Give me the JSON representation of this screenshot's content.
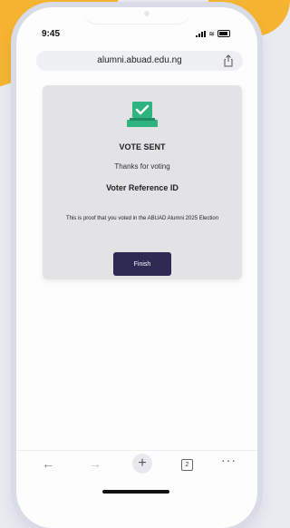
{
  "status": {
    "time": "9:45"
  },
  "browser": {
    "url": "alumni.abuad.edu.ng"
  },
  "card": {
    "title": "VOTE SENT",
    "thanks": "Thanks for voting",
    "reference_label": "Voter Reference ID",
    "proof_text": "This is proof that you voted in the ABUAD Alumni 2025 Election",
    "finish_label": "Finish"
  },
  "toolbar": {
    "tabs_count": "2"
  },
  "icons": {
    "ballot": "ballot-box-check-icon",
    "share": "share-icon",
    "back": "back-arrow-icon",
    "forward": "forward-arrow-icon",
    "new_tab": "plus-icon",
    "tabs": "tabs-icon",
    "more": "more-icon"
  },
  "colors": {
    "accent": "#2e2a53",
    "success": "#2fb37f",
    "background_blob": "#f5b431"
  }
}
